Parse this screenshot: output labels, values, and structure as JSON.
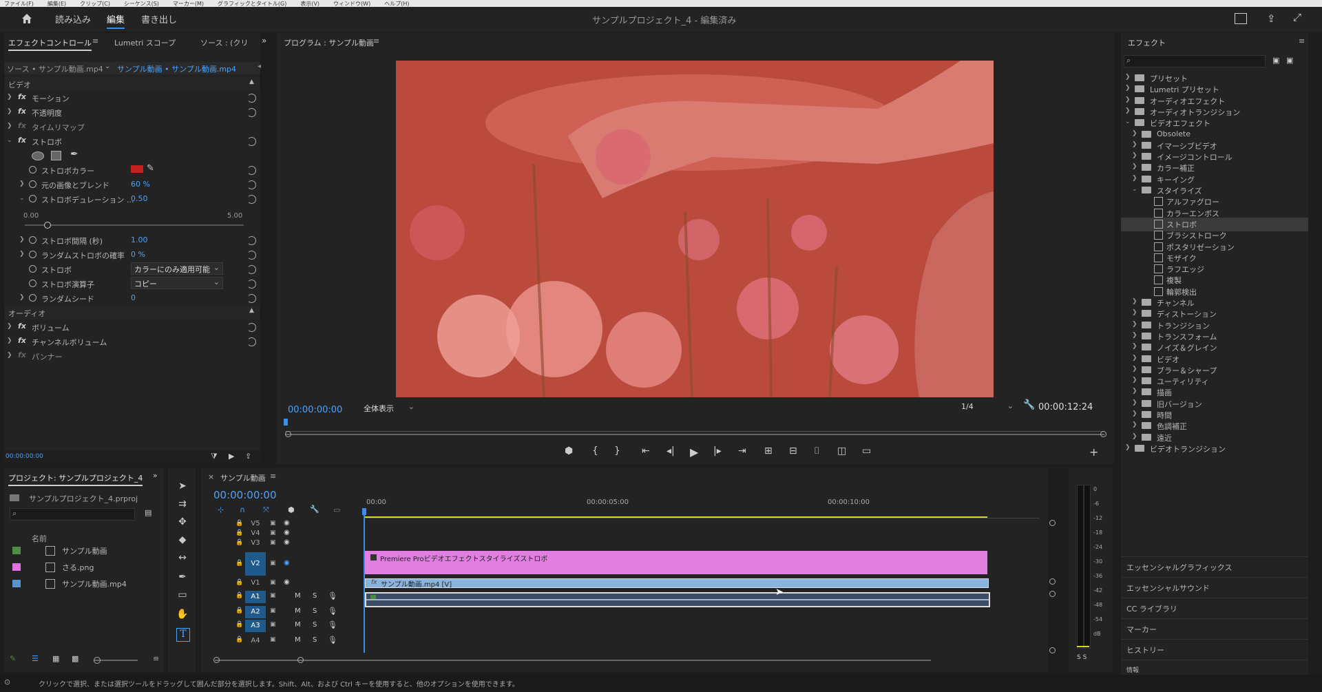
{
  "menubar": {
    "items": [
      "ファイル(F)",
      "編集(E)",
      "クリップ(C)",
      "シーケンス(S)",
      "マーカー(M)",
      "グラフィックとタイトル(G)",
      "表示(V)",
      "ウィンドウ(W)",
      "ヘルプ(H)"
    ]
  },
  "topbar": {
    "tabs": [
      "読み込み",
      "編集",
      "書き出し"
    ],
    "title": "サンプルプロジェクト_4 - 編集済み"
  },
  "effect_controls": {
    "tabs": [
      "エフェクトコントロール",
      "Lumetri スコープ",
      "ソース : (クリ"
    ],
    "source_label": "ソース • サンプル動画.mp4",
    "clip_label": "サンプル動画 • サンプル動画.mp4",
    "video_header": "ビデオ",
    "rows": {
      "motion": "モーション",
      "opacity": "不透明度",
      "time_remap": "タイムリマップ",
      "strobe": "ストロボ",
      "strobe_color": "ストロボカラー",
      "blend_original": "元の画像とブレンド",
      "blend_value": "60 %",
      "duration": "ストロボデュレーション ...",
      "duration_value": "0.50",
      "slider_min": "0.00",
      "slider_max": "5.00",
      "interval": "ストロボ間隔 (秒)",
      "interval_value": "1.00",
      "random_prob": "ランダムストロボの確率",
      "random_prob_value": "0 %",
      "strobe_type": "ストロボ",
      "strobe_type_value": "カラーにのみ適用可能",
      "operator": "ストロボ演算子",
      "operator_value": "コピー",
      "random_seed": "ランダムシード",
      "random_seed_value": "0"
    },
    "audio_header": "オーディオ",
    "audio_rows": [
      "ボリューム",
      "チャンネルボリューム",
      "パンナー"
    ],
    "timecode": "00:00:00:00",
    "strobe_color_hex": "#c0231f",
    "duration_level": 0.1
  },
  "program": {
    "title": "プログラム : サンプル動画",
    "timecode": "00:00:00:00",
    "fit": "全体表示",
    "quality": "1/4",
    "duration": "00:00:12:24"
  },
  "effects": {
    "title": "エフェクト",
    "tree": [
      {
        "label": "プリセット",
        "level": 0
      },
      {
        "label": "Lumetri プリセット",
        "level": 0
      },
      {
        "label": "オーディオエフェクト",
        "level": 0
      },
      {
        "label": "オーディオトランジション",
        "level": 0
      },
      {
        "label": "ビデオエフェクト",
        "level": 0,
        "open": true
      },
      {
        "label": "Obsolete",
        "level": 1
      },
      {
        "label": "イマーシブビデオ",
        "level": 1
      },
      {
        "label": "イメージコントロール",
        "level": 1
      },
      {
        "label": "カラー補正",
        "level": 1
      },
      {
        "label": "キーイング",
        "level": 1
      },
      {
        "label": "スタイライズ",
        "level": 1,
        "open": true
      },
      {
        "label": "アルファグロー",
        "level": 2
      },
      {
        "label": "カラーエンボス",
        "level": 2
      },
      {
        "label": "ストロボ",
        "level": 2,
        "selected": true
      },
      {
        "label": "ブラシストローク",
        "level": 2
      },
      {
        "label": "ポスタリゼーション",
        "level": 2
      },
      {
        "label": "モザイク",
        "level": 2
      },
      {
        "label": "ラフエッジ",
        "level": 2
      },
      {
        "label": "複製",
        "level": 2
      },
      {
        "label": "輪郭検出",
        "level": 2
      },
      {
        "label": "チャンネル",
        "level": 1
      },
      {
        "label": "ディストーション",
        "level": 1
      },
      {
        "label": "トランジション",
        "level": 1
      },
      {
        "label": "トランスフォーム",
        "level": 1
      },
      {
        "label": "ノイズ＆グレイン",
        "level": 1
      },
      {
        "label": "ビデオ",
        "level": 1
      },
      {
        "label": "ブラー＆シャープ",
        "level": 1
      },
      {
        "label": "ユーティリティ",
        "level": 1
      },
      {
        "label": "描画",
        "level": 1
      },
      {
        "label": "旧バージョン",
        "level": 1
      },
      {
        "label": "時間",
        "level": 1
      },
      {
        "label": "色調補正",
        "level": 1
      },
      {
        "label": "遠近",
        "level": 1
      },
      {
        "label": "ビデオトランジション",
        "level": 0
      }
    ],
    "sections": [
      "エッセンシャルグラフィックス",
      "エッセンシャルサウンド",
      "CC ライブラリ",
      "マーカー",
      "ヒストリー",
      "情報"
    ]
  },
  "project": {
    "title": "プロジェクト: サンプルプロジェクト_4",
    "file": "サンプルプロジェクト_4.prproj",
    "column_name": "名前",
    "items": [
      {
        "label": "サンプル動画",
        "color": "#4f8a46"
      },
      {
        "label": "さる.png",
        "color": "#e272e2"
      },
      {
        "label": "サンプル動画.mp4",
        "color": "#5a94cc"
      }
    ]
  },
  "timeline": {
    "title": "サンプル動画",
    "timecode": "00:00:00:00",
    "ruler": [
      "00:00",
      "00:00:05:00",
      "00:00:10:00"
    ],
    "tracks_v": [
      "V5",
      "V4",
      "V3",
      "V2",
      "V1"
    ],
    "tracks_a": [
      "A1",
      "A2",
      "A3",
      "A4"
    ],
    "clip_v2": "Premiere Proビデオエフェクトスタイライズストロボ",
    "clip_v1": "サンプル動画.mp4 [V]",
    "mute": "M",
    "solo": "S"
  },
  "meter": {
    "scale": [
      "0",
      "-6",
      "-12",
      "-18",
      "-24",
      "-30",
      "-36",
      "-42",
      "-48",
      "-54",
      "dB"
    ],
    "solo": "S S"
  },
  "status": "クリックで選択、または選択ツールをドラッグして囲んだ部分を選択します。Shift、Alt、および Ctrl キーを使用すると、他のオプションを使用できます。"
}
